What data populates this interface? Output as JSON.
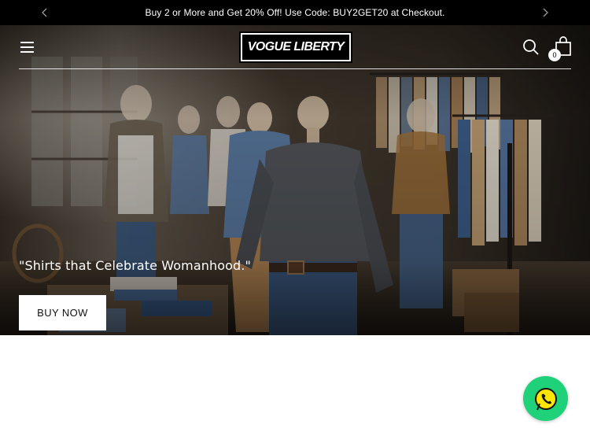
{
  "announcement": {
    "text": "Buy 2 or More and Get 20% Off! Use Code: BUY2GET20 at Checkout.",
    "prev_icon": "chevron-left-icon",
    "next_icon": "chevron-right-icon"
  },
  "header": {
    "logo_text": "VOGUE LIBERTY",
    "menu_icon": "hamburger-icon",
    "search_icon": "search-icon",
    "cart_icon": "shopping-bag-icon",
    "cart_count": "0"
  },
  "hero": {
    "heading": "\"Shirts that Celebrate Womanhood.\"",
    "button_label": "BUY NOW"
  },
  "floating": {
    "whatsapp_icon": "whatsapp-icon",
    "whatsapp_color": "#1fd178"
  }
}
